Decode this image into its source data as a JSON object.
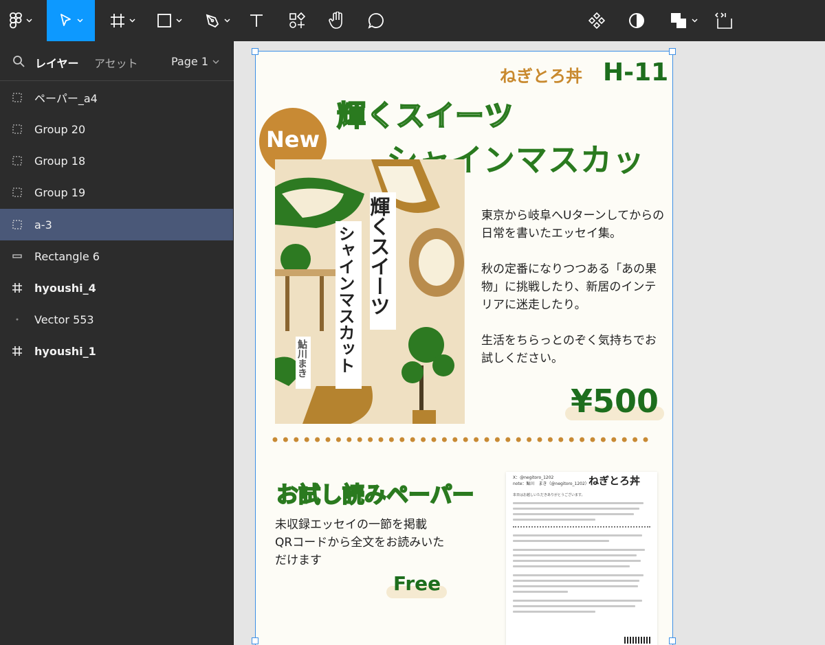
{
  "toolbar": {
    "tools": [
      "main-menu",
      "move",
      "frame",
      "shape",
      "pen",
      "text",
      "resources",
      "hand",
      "comment"
    ],
    "right_tools": [
      "component",
      "contrast",
      "boolean",
      "dev-mode"
    ]
  },
  "sidebar": {
    "tab_layers": "レイヤー",
    "tab_assets": "アセット",
    "page_selector": "Page 1",
    "layers": [
      {
        "label": "ペーパー_a4",
        "icon": "group-icon"
      },
      {
        "label": "Group 20",
        "icon": "group-icon"
      },
      {
        "label": "Group 18",
        "icon": "group-icon"
      },
      {
        "label": "Group 19",
        "icon": "group-icon"
      },
      {
        "label": "a-3",
        "icon": "group-icon",
        "selected": true
      },
      {
        "label": "Rectangle 6",
        "icon": "rectangle-icon"
      },
      {
        "label": "hyoushi_4",
        "icon": "frame-icon"
      },
      {
        "label": "Vector 553",
        "icon": "vector-icon"
      },
      {
        "label": "hyoushi_1",
        "icon": "frame-icon"
      }
    ]
  },
  "paper": {
    "brand": "ねぎとろ丼",
    "code": "H-11",
    "title_line1": "輝くスイーツ",
    "title_line2": "シャインマスカット",
    "new_badge": "New",
    "cover_title": "輝くスイーツ",
    "cover_subtitle": "シャインマスカット",
    "cover_author": "鮎川まき",
    "description": [
      "東京から岐阜へUターンしてからの日常を書いたエッセイ集。",
      "秋の定番になりつつある「あの果物」に挑戦したり、新居のインテリアに迷走したり。",
      "生活をちらっとのぞく気持ちでお試しください。"
    ],
    "price": "¥500",
    "trial_title": "お試し読みペーパー",
    "trial_text": [
      "未収録エッセイの一節を掲載",
      "QRコードから全文をお読みいた",
      "だけます"
    ],
    "free_label": "Free",
    "mini": {
      "handle_x": "X：@negitoro_1202",
      "handle_note": "note：鮎川　まき（@negitoro_1202）",
      "brand": "ねぎとろ丼",
      "greeting": "本日はお越しいただきありがとうございます。"
    }
  },
  "colors": {
    "accent_green": "#2a7a1f",
    "accent_orange": "#c88a34",
    "toolbar_bg": "#2c2c2c",
    "selection_blue": "#0d99ff"
  }
}
